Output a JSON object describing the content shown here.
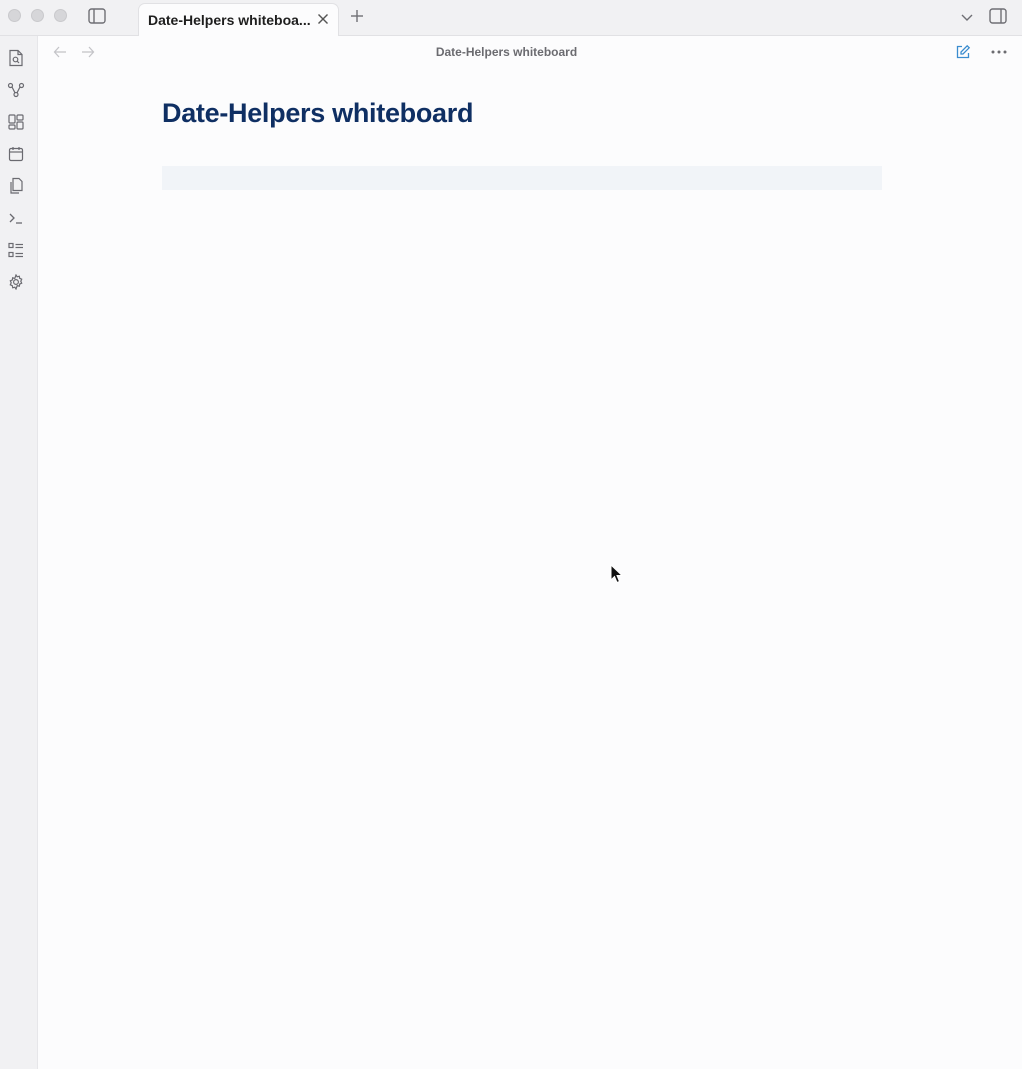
{
  "tab": {
    "title": "Date-Helpers whiteboa..."
  },
  "header": {
    "title": "Date-Helpers whiteboard"
  },
  "document": {
    "heading": "Date-Helpers whiteboard"
  },
  "icons": {
    "ribbon": [
      "search-file-icon",
      "graph-view-icon",
      "canvas-icon",
      "calendar-icon",
      "copy-files-icon",
      "terminal-icon",
      "outline-list-icon",
      "settings-gear-icon"
    ],
    "accent": "#3a8ccf",
    "heading_color": "#0f2f63"
  }
}
